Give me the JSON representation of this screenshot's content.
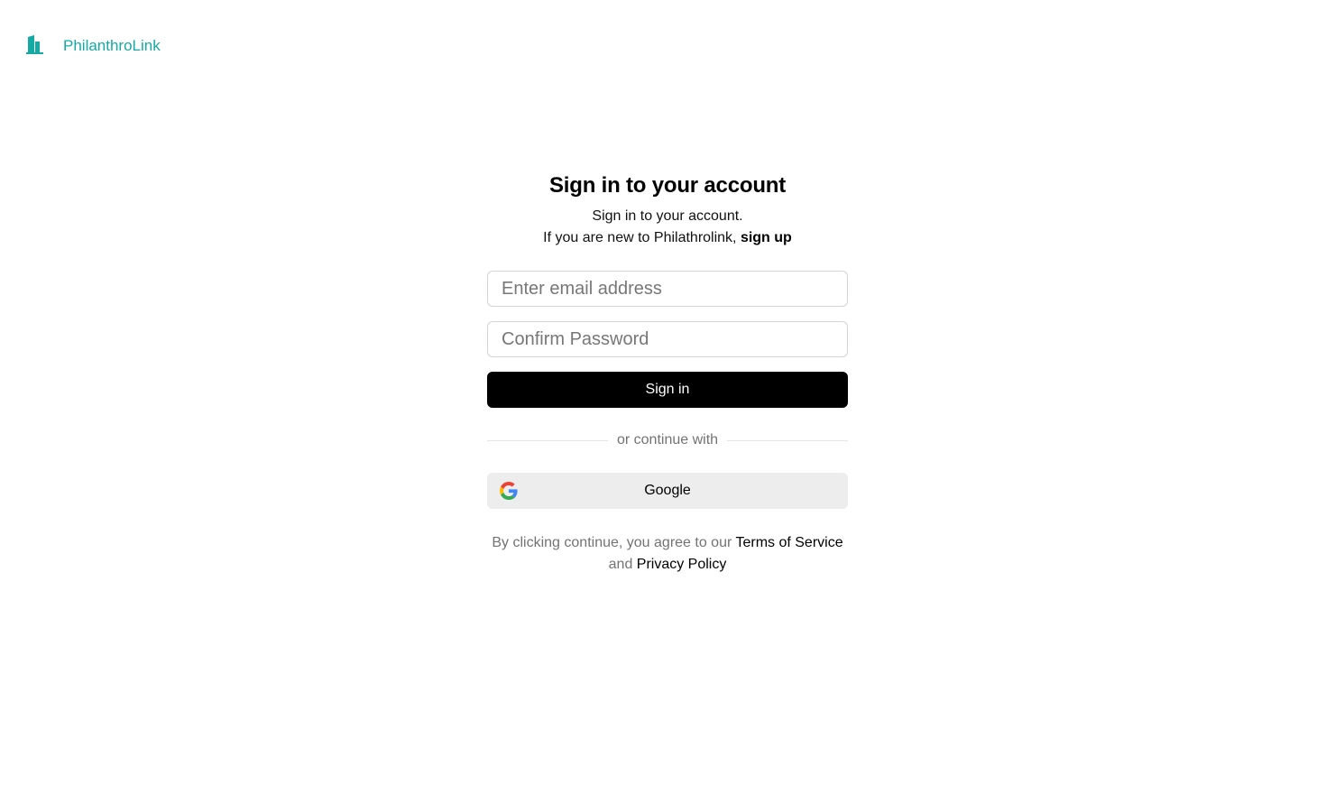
{
  "colors": {
    "accent": "#14a9a4",
    "primary_button": "#000000",
    "secondary_button": "#ededed"
  },
  "header": {
    "logo_icon": "buildings-icon",
    "brand_name": "PhilanthroLink"
  },
  "auth": {
    "title": "Sign in to your account",
    "subtitle_line1": "Sign in to your account.",
    "subtitle_line2_prefix": "If you are new to Philathrolink, ",
    "signup_link": "sign up",
    "email_placeholder": "Enter email address",
    "email_value": "",
    "password_placeholder": "Confirm Password",
    "password_value": "",
    "signin_button": "Sign in",
    "divider_text": "or continue with",
    "google_icon": "google-icon",
    "google_button": "Google",
    "terms_prefix": "By clicking continue, you agree to our ",
    "terms_link": "Terms of Service",
    "terms_and": " and ",
    "privacy_link": "Privacy Policy"
  }
}
